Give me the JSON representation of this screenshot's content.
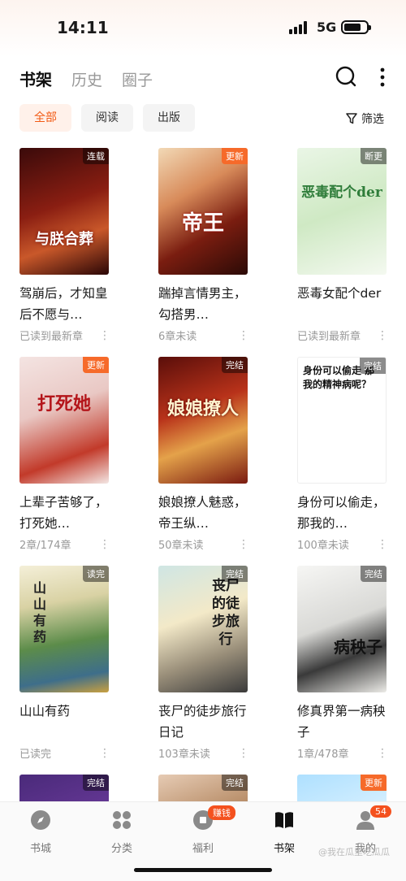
{
  "status": {
    "time": "14:11",
    "network": "5G"
  },
  "tabs": [
    {
      "label": "书架",
      "active": true
    },
    {
      "label": "历史"
    },
    {
      "label": "圈子"
    }
  ],
  "filters": {
    "items": [
      "全部",
      "阅读",
      "出版"
    ],
    "active": "全部",
    "filter_label": "筛选"
  },
  "books": [
    {
      "title": "驾崩后，才知皇后不愿与…",
      "meta": "已读到最新章",
      "badge": "连载",
      "art": "与朕合葬"
    },
    {
      "title": "踹掉言情男主，勾搭男…",
      "meta": "6章未读",
      "badge": "更新",
      "art": "帝王"
    },
    {
      "title": "恶毒女配个der",
      "meta": "已读到最新章",
      "badge": "断更",
      "art": "恶毒配个der"
    },
    {
      "title": "上辈子苦够了，打死她…",
      "meta": "2章/174章",
      "badge": "更新",
      "art": "打死她"
    },
    {
      "title": "娘娘撩人魅惑，帝王纵…",
      "meta": "50章未读",
      "badge": "完结",
      "art": "娘娘撩人"
    },
    {
      "title": "身份可以偷走，那我的…",
      "meta": "100章未读",
      "badge": "完结",
      "art": "身份可以偷走 那我的精神病呢？"
    },
    {
      "title": "山山有药",
      "meta": "已读完",
      "badge": "读完",
      "art": "山山有药"
    },
    {
      "title": "丧尸的徒步旅行日记",
      "meta": "103章未读",
      "badge": "完结",
      "art": "丧尸的徒步旅行"
    },
    {
      "title": "修真界第一病秧子",
      "meta": "1章/478章",
      "badge": "完结",
      "art": "病秧子"
    },
    {
      "badge": "完结"
    },
    {
      "badge": "完结"
    },
    {
      "badge": "更新"
    }
  ],
  "nav": [
    {
      "label": "书城",
      "icon": "compass-icon"
    },
    {
      "label": "分类",
      "icon": "grid-icon"
    },
    {
      "label": "福利",
      "icon": "gift-icon",
      "badge": "赚钱"
    },
    {
      "label": "书架",
      "icon": "book-icon",
      "active": true
    },
    {
      "label": "我的",
      "icon": "user-icon",
      "badge": "54"
    }
  ],
  "watermark": "@我在瓜里吃瓜瓜",
  "colors": {
    "accent": "#f25a14",
    "badge_new": "#f66a2a"
  }
}
